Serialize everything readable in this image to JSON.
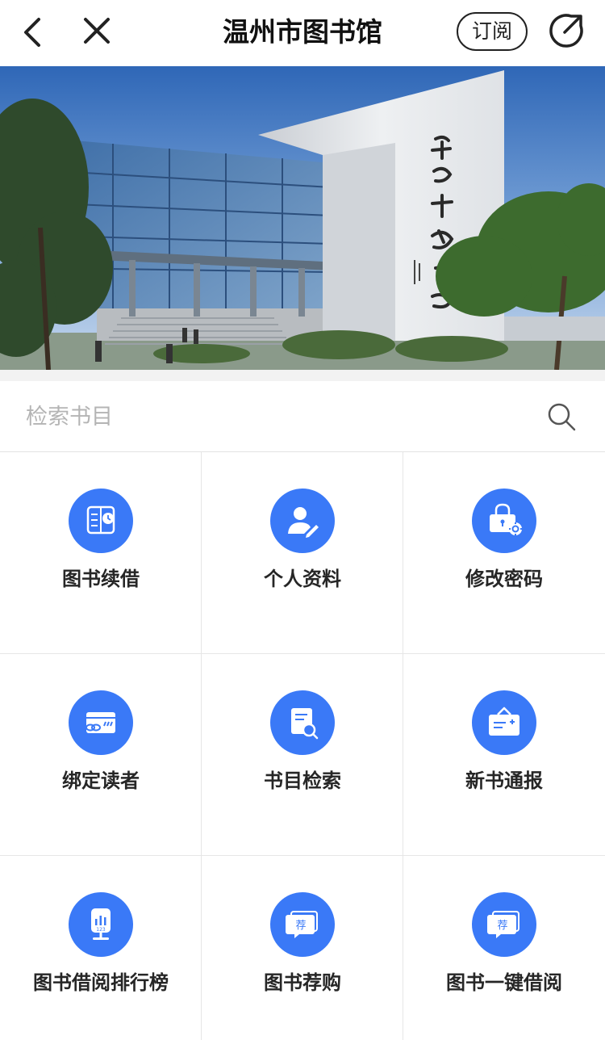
{
  "navbar": {
    "title": "温州市图书馆",
    "subscribe_label": "订阅",
    "icons": [
      "back-arrow-icon",
      "close-icon",
      "share-icon"
    ]
  },
  "banner": {
    "sign_text": "温州市图书馆"
  },
  "search": {
    "placeholder": "检索书目",
    "icon": "search-icon"
  },
  "colors": {
    "accent": "#3a79f7",
    "divider": "#e6e6e6",
    "background_gap": "#f2f2f2"
  },
  "menu": [
    {
      "label": "图书续借",
      "icon": "book-renew-icon"
    },
    {
      "label": "个人资料",
      "icon": "user-edit-icon"
    },
    {
      "label": "修改密码",
      "icon": "lock-gear-icon"
    },
    {
      "label": "绑定读者",
      "icon": "card-link-icon"
    },
    {
      "label": "书目检索",
      "icon": "document-search-icon"
    },
    {
      "label": "新书通报",
      "icon": "notice-board-icon"
    },
    {
      "label": "图书借阅排行榜",
      "icon": "ranking-chart-icon"
    },
    {
      "label": "图书荐购",
      "icon": "recommend-chat-icon",
      "badge": "荐"
    },
    {
      "label": "图书一键借阅",
      "icon": "recommend-chat-icon",
      "badge": "荐"
    }
  ]
}
